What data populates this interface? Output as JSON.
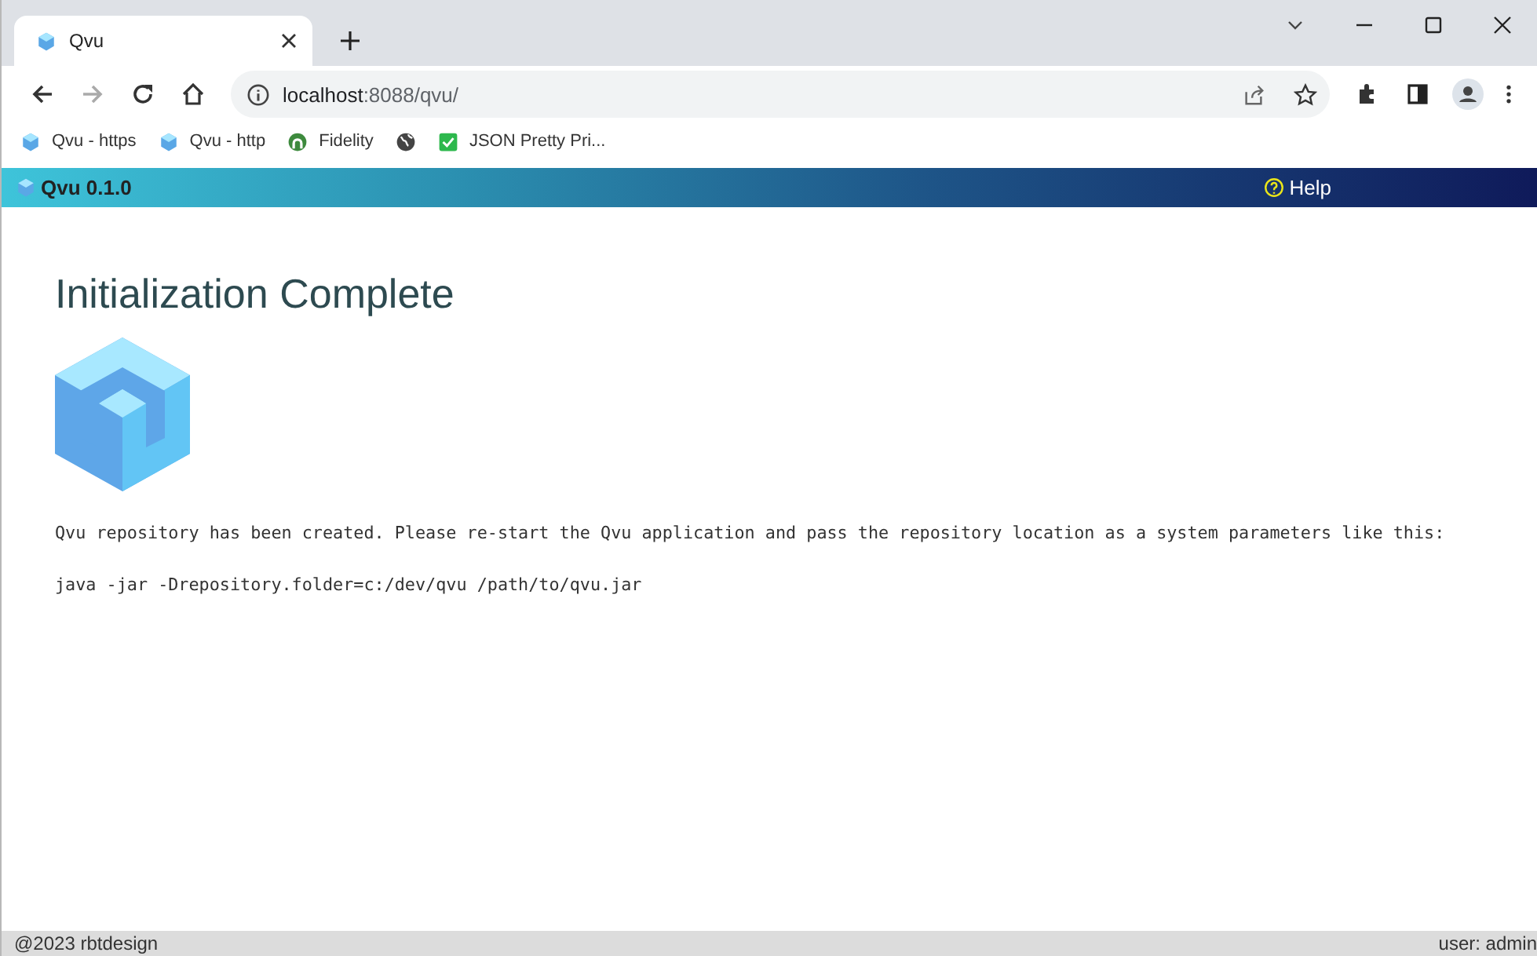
{
  "browser": {
    "tab": {
      "title": "Qvu"
    },
    "url_host": "localhost",
    "url_rest": ":8088/qvu/",
    "bookmarks": [
      {
        "kind": "cube",
        "label": "Qvu - https"
      },
      {
        "kind": "cube",
        "label": "Qvu - http"
      },
      {
        "kind": "fidelity",
        "label": "Fidelity"
      },
      {
        "kind": "globe"
      },
      {
        "kind": "check",
        "label": "JSON Pretty Pri..."
      }
    ]
  },
  "app_header": {
    "title": "Qvu 0.1.0",
    "help": "Help"
  },
  "content": {
    "heading": "Initialization Complete",
    "message": "Qvu repository has been created. Please re-start the Qvu application and pass the repository location as a system parameters like this:",
    "command": "java -jar -Drepository.folder=c:/dev/qvu /path/to/qvu.jar"
  },
  "footer": {
    "left": "@2023 rbtdesign",
    "right": "user: admin"
  }
}
